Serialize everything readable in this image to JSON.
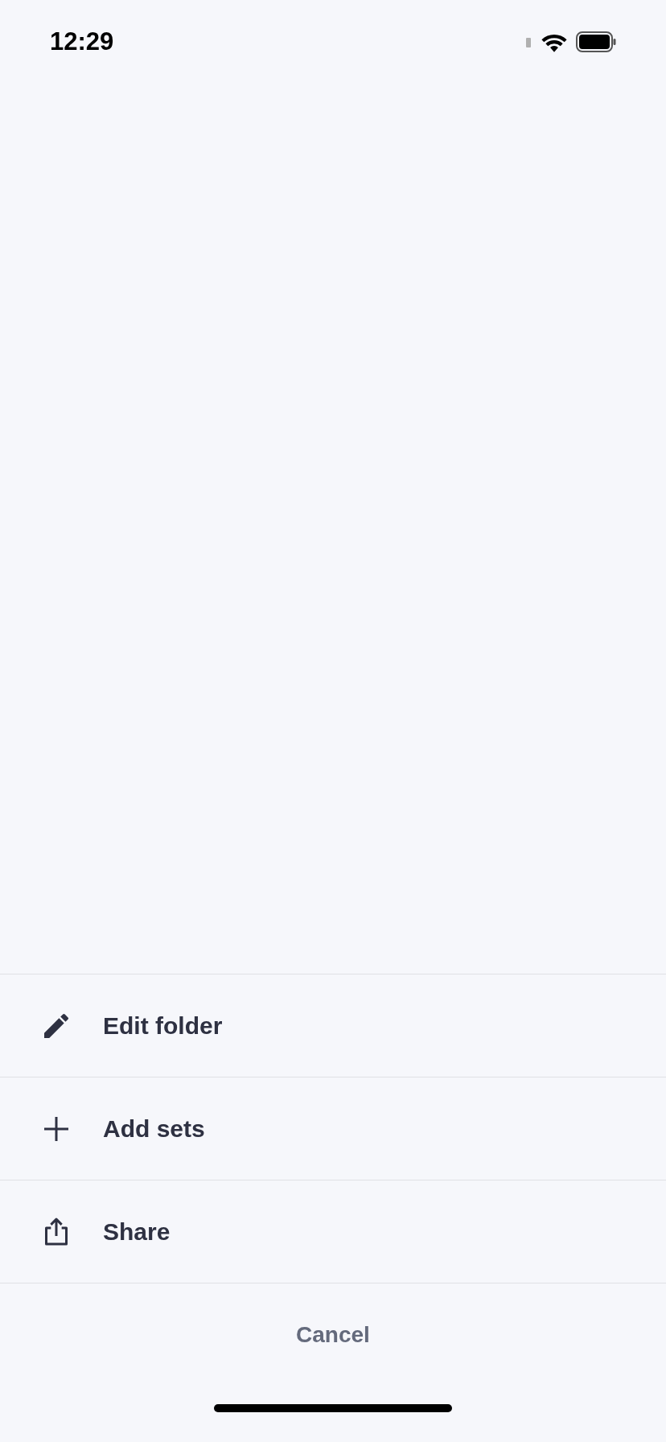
{
  "status_bar": {
    "time": "12:29"
  },
  "actions": [
    {
      "kind": "edit",
      "label": "Edit folder"
    },
    {
      "kind": "add",
      "label": "Add sets"
    },
    {
      "kind": "share",
      "label": "Share"
    }
  ],
  "cancel": "Cancel"
}
